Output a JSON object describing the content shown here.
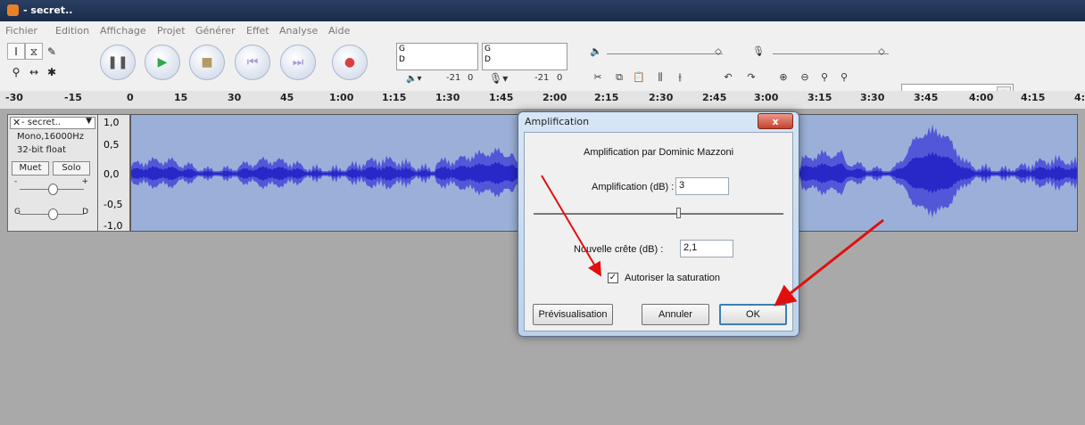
{
  "window": {
    "title": "- secret..",
    "icon": "audacity-icon"
  },
  "menu": [
    "Fichier",
    "Edition",
    "Affichage",
    "Projet",
    "Générer",
    "Effet",
    "Analyse",
    "Aide"
  ],
  "meters": {
    "play": {
      "left": "G",
      "right": "D",
      "db": "-21",
      "zero": "0"
    },
    "record": {
      "left": "G",
      "right": "D",
      "db": "-21",
      "zero": "0"
    }
  },
  "ruler": [
    "-30",
    "-15",
    "0",
    "15",
    "30",
    "45",
    "1:00",
    "1:15",
    "1:30",
    "1:45",
    "2:00",
    "2:15",
    "2:30",
    "2:45",
    "3:00",
    "3:15",
    "3:30",
    "3:45",
    "4:00",
    "4:15",
    "4:"
  ],
  "track": {
    "name": "- secret..",
    "format": "Mono,16000Hz",
    "bits": "32-bit float",
    "mute": "Muet",
    "solo": "Solo",
    "gain_minus": "-",
    "gain_plus": "+",
    "pan_left": "G",
    "pan_right": "D",
    "scale": [
      "1,0",
      "0,5",
      "0,0",
      "-0,5",
      "-1,0"
    ]
  },
  "dialog": {
    "title": "Amplification",
    "close": "x",
    "credit": "Amplification par Dominic Mazzoni",
    "amp_label": "Amplification (dB) :",
    "amp_value": "3",
    "peak_label": "Nouvelle crête (dB) :",
    "peak_value": "2,1",
    "clip_label": "Autoriser la saturation",
    "clip_checked": true,
    "preview": "Prévisualisation",
    "cancel": "Annuler",
    "ok": "OK"
  },
  "colors": {
    "waveform": "#3a3ad8",
    "arrow": "#e01010",
    "title_bar": "#1f3252"
  }
}
